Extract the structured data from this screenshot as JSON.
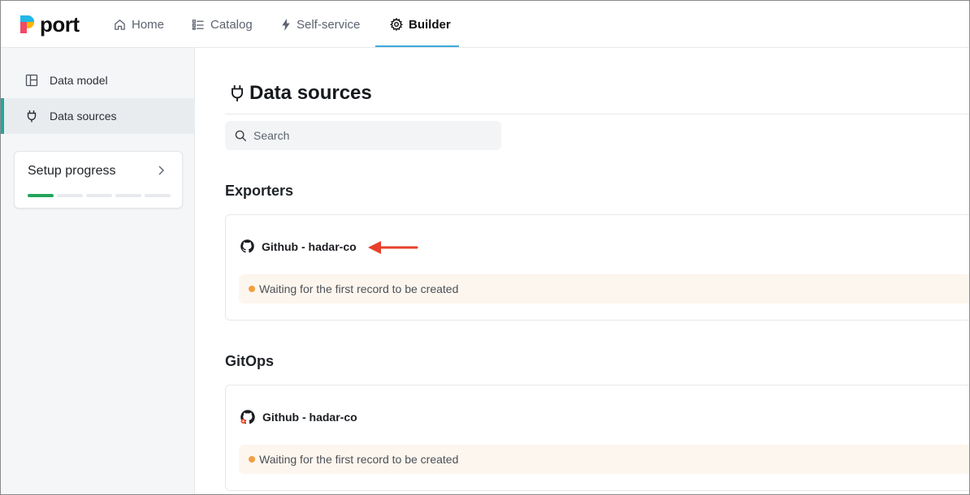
{
  "app": {
    "logo_text": "port"
  },
  "nav": {
    "items": [
      {
        "label": "Home",
        "icon": "home-icon"
      },
      {
        "label": "Catalog",
        "icon": "list-icon"
      },
      {
        "label": "Self-service",
        "icon": "lightning-icon"
      },
      {
        "label": "Builder",
        "icon": "gear-icon",
        "active": true
      }
    ],
    "accent_color": "#3ea9d8"
  },
  "sidebar": {
    "items": [
      {
        "label": "Data model",
        "icon": "layout-icon"
      },
      {
        "label": "Data sources",
        "icon": "plug-icon",
        "active": true
      }
    ],
    "setup": {
      "title": "Setup progress",
      "steps_total": 5,
      "steps_done": 1,
      "done_color": "#22a55a"
    }
  },
  "main": {
    "title": "Data sources",
    "search": {
      "placeholder": "Search",
      "value": ""
    },
    "sections": [
      {
        "title": "Exporters",
        "cards": [
          {
            "name": "Github - hadar-co",
            "icon": "github-icon",
            "status": "Waiting for the first record to be created"
          }
        ]
      },
      {
        "title": "GitOps",
        "cards": [
          {
            "name": "Github - hadar-co",
            "icon": "github-gitops-icon",
            "status": "Waiting for the first record to be created"
          }
        ]
      }
    ],
    "annotation_arrow_color": "#e8402a",
    "status_dot_color": "#f0a040"
  }
}
